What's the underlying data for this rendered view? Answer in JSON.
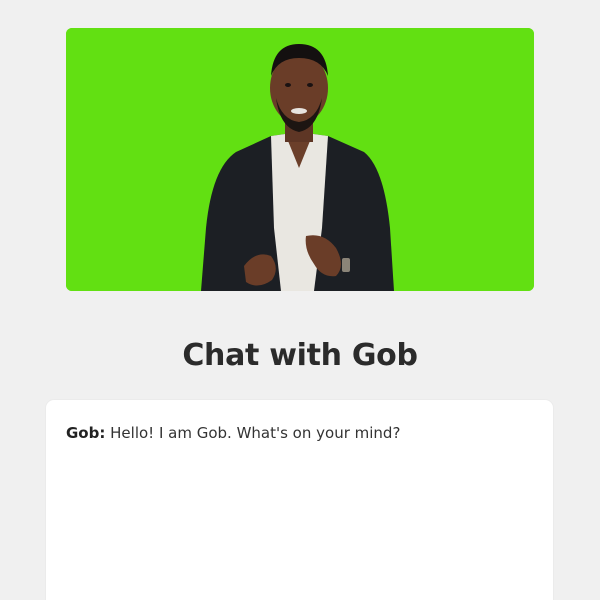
{
  "avatar_video": {
    "background_color": "#62e012"
  },
  "chat": {
    "title": "Chat with Gob",
    "messages": [
      {
        "sender": "Gob:",
        "text": "Hello! I am Gob. What's on your mind?"
      }
    ]
  }
}
